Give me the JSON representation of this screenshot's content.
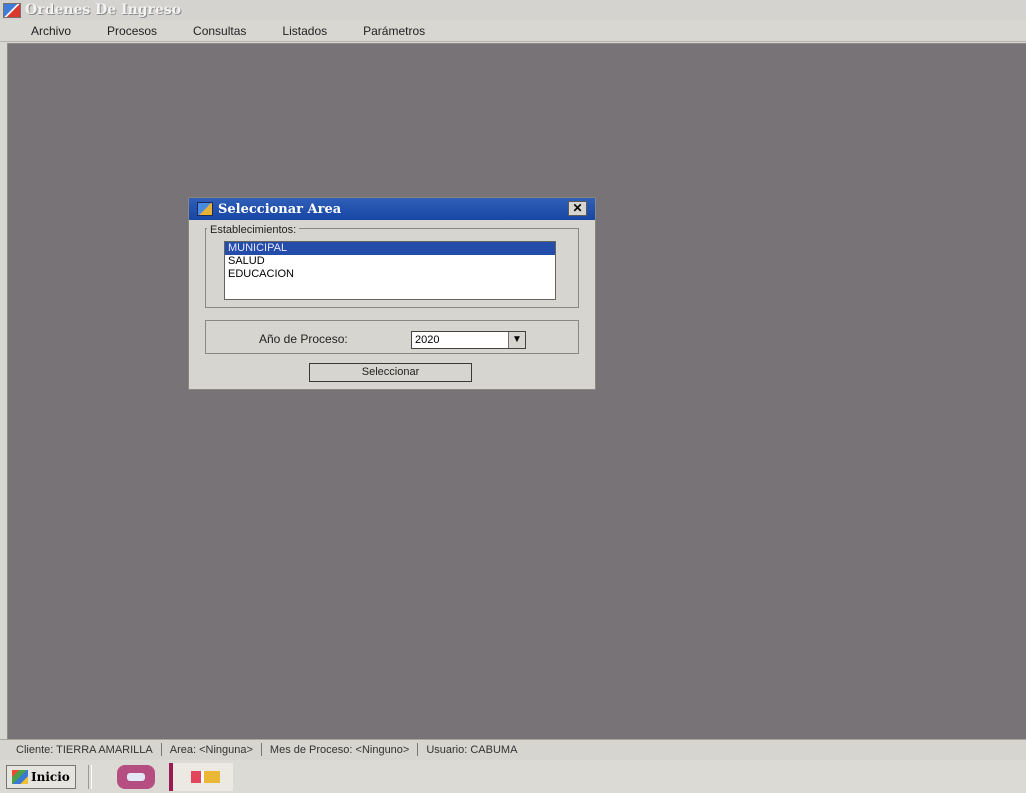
{
  "app": {
    "title": "Ordenes De Ingreso"
  },
  "menu": [
    "Archivo",
    "Procesos",
    "Consultas",
    "Listados",
    "Parámetros"
  ],
  "dialog": {
    "title": "Seleccionar Area",
    "close_glyph": "✕",
    "group_label": "Establecimientos:",
    "items": [
      "MUNICIPAL",
      "SALUD",
      "EDUCACION"
    ],
    "selected_item": "MUNICIPAL",
    "year_label": "Año de Proceso:",
    "year_value": "2020",
    "select_button": "Seleccionar"
  },
  "status": {
    "cliente": "Cliente: TIERRA AMARILLA",
    "area": "Area: <Ninguna>",
    "mes": "Mes de Proceso: <Ninguno>",
    "usuario": "Usuario: CABUMA"
  },
  "taskbar": {
    "start_label": "Inicio"
  },
  "icons": {
    "app": "app-window-icon",
    "dialog": "form-icon",
    "start": "windows-logo-icon",
    "quick_launch": "car-icon",
    "task": "flag-app-icon"
  }
}
